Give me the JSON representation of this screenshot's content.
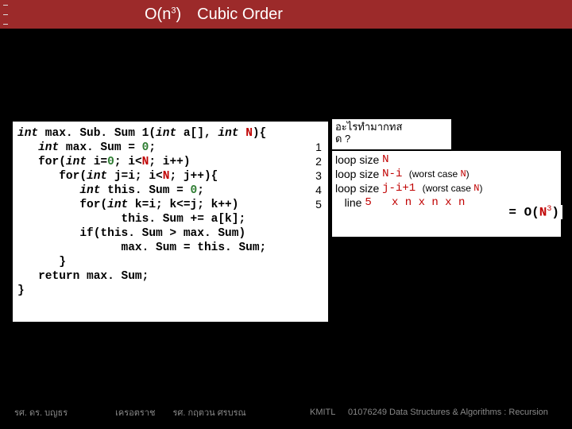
{
  "title": {
    "bigO_prefix": "O(n",
    "bigO_exp": "3",
    "bigO_suffix": ")",
    "gap": " ",
    "label": "Cubic Order"
  },
  "code": {
    "l1_a": "int",
    "l1_b": " max. Sub. Sum 1(",
    "l1_c": "int",
    "l1_d": " a[], ",
    "l1_e": "int",
    "l1_f": " ",
    "l1_g": "N",
    "l1_h": "){",
    "l2_a": "   int",
    "l2_b": " max. Sum = ",
    "l2_c": "0",
    "l2_d": ";",
    "l3_a": "   for(",
    "l3_b": "int",
    "l3_c": " i=",
    "l3_d": "0",
    "l3_e": "; i<",
    "l3_f": "N",
    "l3_g": "; i++)",
    "l4_a": "      for(",
    "l4_b": "int",
    "l4_c": " j=i; i<",
    "l4_d": "N",
    "l4_e": "; j++){",
    "l5_a": "         int",
    "l5_b": " this. Sum = ",
    "l5_c": "0",
    "l5_d": ";",
    "l6_a": "         for(",
    "l6_b": "int",
    "l6_c": " k=i; k<=j; k++)",
    "l7": "               this. Sum += a[k];",
    "l8": "         if(this. Sum > max. Sum)",
    "l9": "               max. Sum = this. Sum;",
    "l10": "      }",
    "l11": "   return max. Sum;",
    "l12": "}"
  },
  "linenums": {
    "n1": "1",
    "n2": "2",
    "n3": "3",
    "n4": "4",
    "n5": "5"
  },
  "question": {
    "line1": "อะไรทำมากทส",
    "line2": "ด ?"
  },
  "annot": {
    "r1a": "loop size ",
    "r1b": "N",
    "r2a": "loop size ",
    "r2b": "N-i ",
    "r2c": "(worst case ",
    "r2d": "N",
    "r2e": ")",
    "r3": "",
    "r4a": "loop size ",
    "r4b": "j-i+1 ",
    "r4c": "(worst case ",
    "r4d": "N",
    "r4e": ")",
    "r5a": "   line ",
    "r5b": "5",
    "r5c": "   x n x n x n"
  },
  "result": {
    "eq": "= ",
    "O": "O(",
    "N": "N",
    "exp": "3",
    "close": ")"
  },
  "footer": {
    "left1": "รศ. ดร. บญธร",
    "left2": "เครอตราช",
    "left3": "รศ. กฤตวน ศรบรณ",
    "mid": "KMITL",
    "right": "01076249 Data Structures & Algorithms : Recursion"
  }
}
